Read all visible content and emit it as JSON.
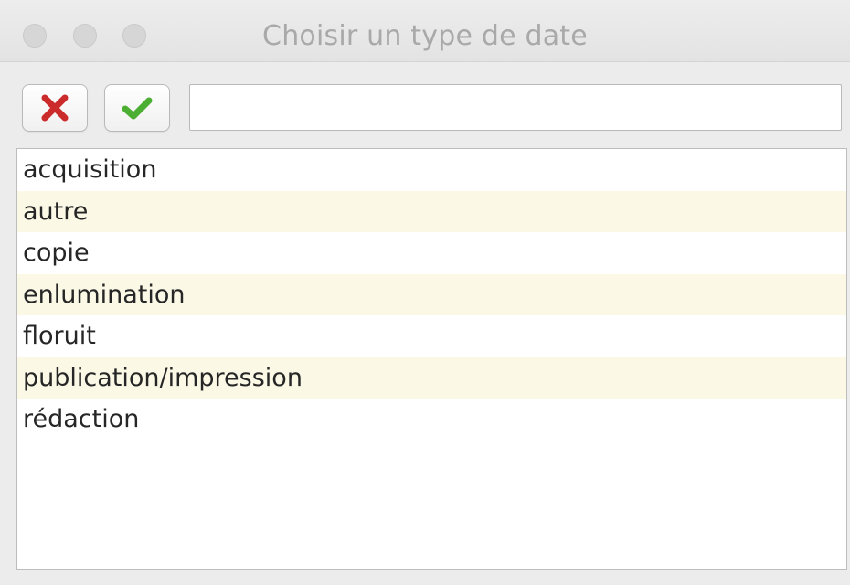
{
  "window": {
    "title": "Choisir un type de date"
  },
  "toolbar": {
    "cancel_icon": "red-x-icon",
    "confirm_icon": "green-checkmark-icon",
    "search_value": "",
    "search_placeholder": ""
  },
  "list": {
    "items": [
      {
        "label": "acquisition"
      },
      {
        "label": "autre"
      },
      {
        "label": "copie"
      },
      {
        "label": "enlumination"
      },
      {
        "label": "floruit"
      },
      {
        "label": "publication/impression"
      },
      {
        "label": "rédaction"
      }
    ]
  },
  "colors": {
    "cancel_red": "#cc2b2b",
    "confirm_green": "#4cae32",
    "stripe": "#fbf9e6",
    "title_text": "#a9a9a9"
  }
}
